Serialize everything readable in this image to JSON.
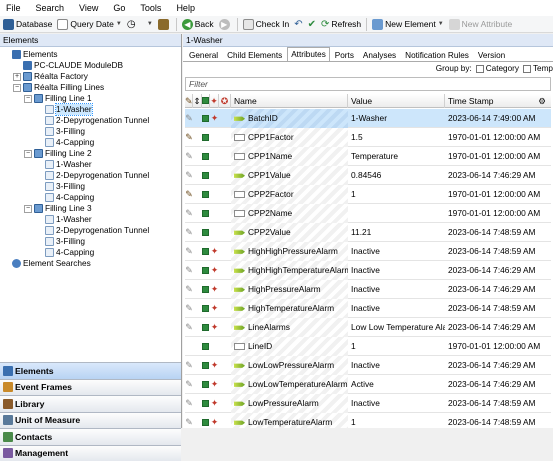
{
  "menu": [
    "File",
    "Search",
    "View",
    "Go",
    "Tools",
    "Help"
  ],
  "toolbar": {
    "database": "Database",
    "query_date": "Query Date",
    "back": "Back",
    "check_in": "Check In",
    "refresh": "Refresh",
    "new_element": "New Element",
    "new_attribute": "New Attribute"
  },
  "left": {
    "title": "Elements",
    "tree": [
      {
        "label": "Elements",
        "depth": 0,
        "exp": "",
        "icon": "db"
      },
      {
        "label": "PC-CLAUDE ModuleDB",
        "depth": 1,
        "exp": "",
        "icon": "db"
      },
      {
        "label": "Réalta Factory",
        "depth": 1,
        "exp": "+",
        "icon": "el"
      },
      {
        "label": "Réalta Filling Lines",
        "depth": 1,
        "exp": "−",
        "icon": "el"
      },
      {
        "label": "Filling Line 1",
        "depth": 2,
        "exp": "−",
        "icon": "el"
      },
      {
        "label": "1-Washer",
        "depth": 3,
        "exp": "",
        "icon": "leaf",
        "selected": true
      },
      {
        "label": "2-Depyrogenation Tunnel",
        "depth": 3,
        "exp": "",
        "icon": "leaf"
      },
      {
        "label": "3-Filling",
        "depth": 3,
        "exp": "",
        "icon": "leaf"
      },
      {
        "label": "4-Capping",
        "depth": 3,
        "exp": "",
        "icon": "leaf"
      },
      {
        "label": "Filling Line 2",
        "depth": 2,
        "exp": "−",
        "icon": "el"
      },
      {
        "label": "1-Washer",
        "depth": 3,
        "exp": "",
        "icon": "leaf"
      },
      {
        "label": "2-Depyrogenation Tunnel",
        "depth": 3,
        "exp": "",
        "icon": "leaf"
      },
      {
        "label": "3-Filling",
        "depth": 3,
        "exp": "",
        "icon": "leaf"
      },
      {
        "label": "4-Capping",
        "depth": 3,
        "exp": "",
        "icon": "leaf"
      },
      {
        "label": "Filling Line 3",
        "depth": 2,
        "exp": "−",
        "icon": "el"
      },
      {
        "label": "1-Washer",
        "depth": 3,
        "exp": "",
        "icon": "leaf"
      },
      {
        "label": "2-Depyrogenation Tunnel",
        "depth": 3,
        "exp": "",
        "icon": "leaf"
      },
      {
        "label": "3-Filling",
        "depth": 3,
        "exp": "",
        "icon": "leaf"
      },
      {
        "label": "4-Capping",
        "depth": 3,
        "exp": "",
        "icon": "leaf"
      },
      {
        "label": "Element Searches",
        "depth": 0,
        "exp": "",
        "icon": "search"
      }
    ],
    "nav": [
      "Elements",
      "Event Frames",
      "Library",
      "Unit of Measure",
      "Contacts",
      "Management"
    ]
  },
  "right": {
    "title": "1-Washer",
    "tabs": [
      "General",
      "Child Elements",
      "Attributes",
      "Ports",
      "Analyses",
      "Notification Rules",
      "Version"
    ],
    "active_tab": "Attributes",
    "group_by_label": "Group by:",
    "group_options": [
      "Category",
      "Temp"
    ],
    "filter_placeholder": "Filter",
    "columns": {
      "name": "Name",
      "value": "Value",
      "timestamp": "Time Stamp"
    },
    "rows": [
      {
        "edit": "light",
        "flags": "sq-star",
        "type": "pi",
        "name": "BatchID",
        "value": "1-Washer",
        "ts": "2023-06-14 7:49:00 AM",
        "selected": true
      },
      {
        "edit": "dark",
        "flags": "sq",
        "type": "static",
        "name": "CPP1Factor",
        "value": "1.5",
        "ts": "1970-01-01 12:00:00 AM"
      },
      {
        "edit": "light",
        "flags": "sq",
        "type": "static",
        "name": "CPP1Name",
        "value": "Temperature",
        "ts": "1970-01-01 12:00:00 AM"
      },
      {
        "edit": "light",
        "flags": "sq",
        "type": "pi",
        "name": "CPP1Value",
        "value": "0.84546",
        "ts": "2023-06-14 7:46:29 AM"
      },
      {
        "edit": "dark",
        "flags": "sq",
        "type": "static",
        "name": "CPP2Factor",
        "value": "1",
        "ts": "1970-01-01 12:00:00 AM"
      },
      {
        "edit": "light",
        "flags": "sq",
        "type": "static",
        "name": "CPP2Name",
        "value": "",
        "ts": "1970-01-01 12:00:00 AM"
      },
      {
        "edit": "light",
        "flags": "sq",
        "type": "pi",
        "name": "CPP2Value",
        "value": "11.21",
        "ts": "2023-06-14 7:48:59 AM"
      },
      {
        "edit": "light",
        "flags": "sq-star",
        "type": "pi",
        "name": "HighHighPressureAlarm",
        "value": "Inactive",
        "ts": "2023-06-14 7:48:59 AM"
      },
      {
        "edit": "light",
        "flags": "sq-star",
        "type": "pi",
        "name": "HighHighTemperatureAlarm",
        "value": "Inactive",
        "ts": "2023-06-14 7:46:29 AM"
      },
      {
        "edit": "light",
        "flags": "sq-star",
        "type": "pi",
        "name": "HighPressureAlarm",
        "value": "Inactive",
        "ts": "2023-06-14 7:46:29 AM"
      },
      {
        "edit": "light",
        "flags": "sq-star",
        "type": "pi",
        "name": "HighTemperatureAlarm",
        "value": "Inactive",
        "ts": "2023-06-14 7:48:59 AM"
      },
      {
        "edit": "light",
        "flags": "sq-star",
        "type": "pi",
        "name": "LineAlarms",
        "value": "Low Low Temperature Alarm",
        "ts": "2023-06-14 7:46:29 AM"
      },
      {
        "edit": "none",
        "flags": "sq",
        "type": "static",
        "name": "LineID",
        "value": "1",
        "ts": "1970-01-01 12:00:00 AM"
      },
      {
        "edit": "light",
        "flags": "sq-star",
        "type": "pi",
        "name": "LowLowPressureAlarm",
        "value": "Inactive",
        "ts": "2023-06-14 7:46:29 AM"
      },
      {
        "edit": "light",
        "flags": "sq-star",
        "type": "pi",
        "name": "LowLowTemperatureAlarm",
        "value": "Active",
        "ts": "2023-06-14 7:46:29 AM"
      },
      {
        "edit": "light",
        "flags": "sq-star",
        "type": "pi",
        "name": "LowPressureAlarm",
        "value": "Inactive",
        "ts": "2023-06-14 7:48:59 AM"
      },
      {
        "edit": "light",
        "flags": "sq-star",
        "type": "pi",
        "name": "LowTemperatureAlarm",
        "value": "1",
        "ts": "2023-06-14 7:48:59 AM"
      }
    ]
  },
  "colors": {
    "selection": "#cde6fb",
    "accent": "#3a6fb0",
    "nav_active": "#b8d3f3"
  }
}
